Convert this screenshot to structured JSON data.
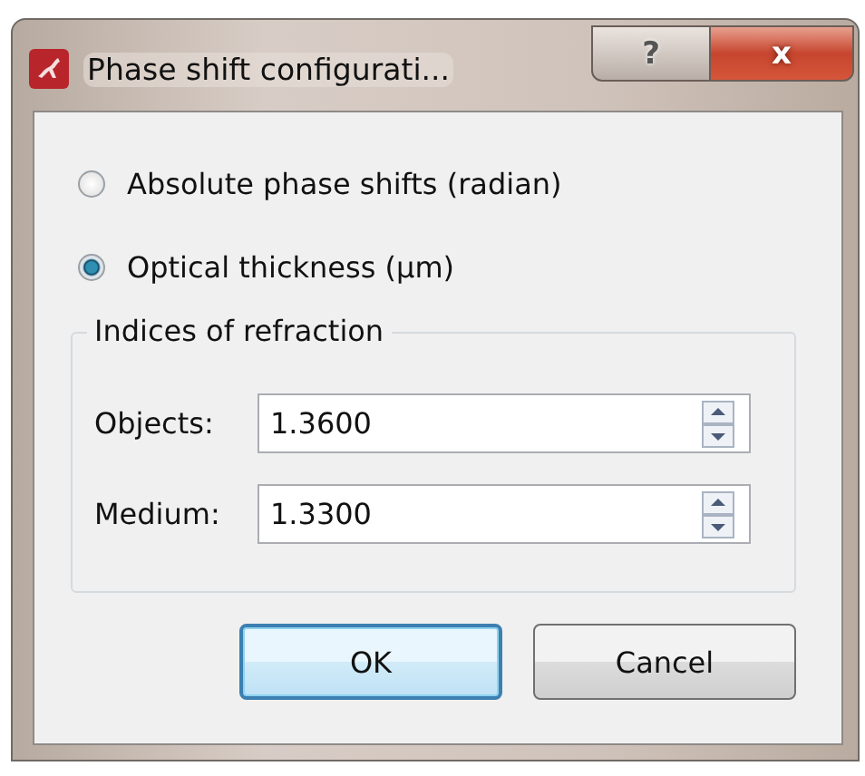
{
  "window": {
    "title": "Phase shift configurati...",
    "help_button": "?",
    "close_button": "x"
  },
  "modes": [
    {
      "label": "Absolute phase shifts (radian)",
      "selected": false
    },
    {
      "label": "Optical thickness (µm)",
      "selected": true
    }
  ],
  "group": {
    "title": "Indices of refraction",
    "fields": [
      {
        "label": "Objects:",
        "value": "1.3600"
      },
      {
        "label": "Medium:",
        "value": "1.3300"
      }
    ]
  },
  "buttons": [
    {
      "label": "OK",
      "default": true
    },
    {
      "label": "Cancel",
      "default": false
    }
  ]
}
